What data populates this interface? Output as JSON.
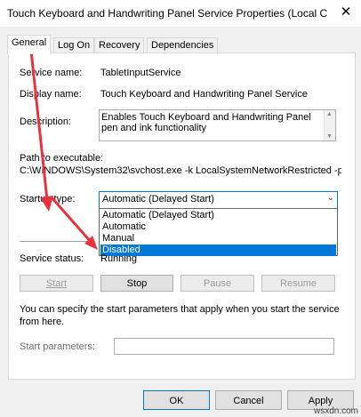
{
  "window": {
    "title": "Touch Keyboard and Handwriting Panel Service Properties (Local C",
    "close_glyph": "✕"
  },
  "tabs": [
    {
      "label": "General"
    },
    {
      "label": "Log On"
    },
    {
      "label": "Recovery"
    },
    {
      "label": "Dependencies"
    }
  ],
  "fields": {
    "service_name_label": "Service name:",
    "service_name_value": "TabletInputService",
    "display_name_label": "Display name:",
    "display_name_value": "Touch Keyboard and Handwriting Panel Service",
    "description_label": "Description:",
    "description_value": "Enables Touch Keyboard and Handwriting Panel pen and ink functionality",
    "path_label": "Path to executable:",
    "path_value": "C:\\WINDOWS\\System32\\svchost.exe -k LocalSystemNetworkRestricted -p",
    "startup_label": "Startup type:"
  },
  "startup": {
    "selected": "Automatic (Delayed Start)",
    "options": [
      "Automatic (Delayed Start)",
      "Automatic",
      "Manual",
      "Disabled"
    ],
    "highlighted": "Disabled",
    "arrow_glyph": "⌄"
  },
  "status": {
    "label": "Service status:",
    "value": "Running"
  },
  "buttons": {
    "start": "Start",
    "stop": "Stop",
    "pause": "Pause",
    "resume": "Resume"
  },
  "params": {
    "info": "You can specify the start parameters that apply when you start the service from here.",
    "label": "Start parameters:",
    "value": ""
  },
  "footer": {
    "ok": "OK",
    "cancel": "Cancel",
    "apply": "Apply"
  },
  "watermark": "wsxdn.com",
  "colors": {
    "annotation_arrow": "#e8323e",
    "selection": "#0078d7"
  }
}
